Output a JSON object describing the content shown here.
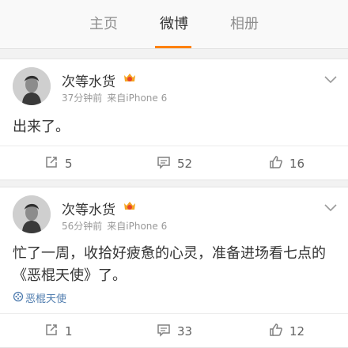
{
  "tabs": [
    {
      "label": "主页"
    },
    {
      "label": "微博"
    },
    {
      "label": "相册"
    }
  ],
  "active_tab_color": "#ff8200",
  "link_color": "#507daf",
  "posts": [
    {
      "username": "次等水货",
      "time": "37分钟前",
      "source": "来自iPhone 6",
      "text": "出来了。",
      "reposts": "5",
      "comments": "52",
      "likes": "16"
    },
    {
      "username": "次等水货",
      "time": "56分钟前",
      "source": "来自iPhone 6",
      "text": "忙了一周，收拾好疲惫的心灵，准备进场看七点的《恶棍天使》了。",
      "topic": "恶棍天使",
      "reposts": "1",
      "comments": "33",
      "likes": "12"
    }
  ]
}
